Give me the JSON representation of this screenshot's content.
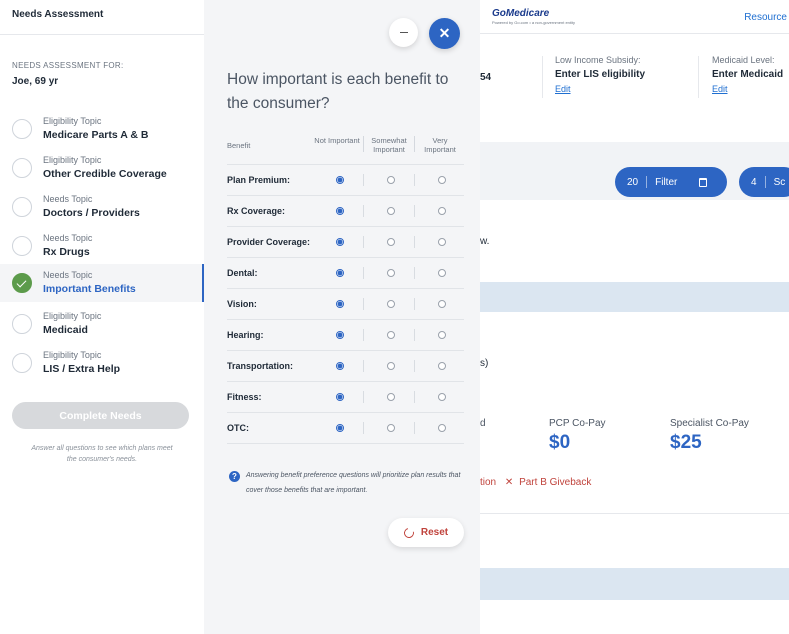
{
  "sidebar": {
    "title": "Needs Assessment",
    "for_label": "NEEDS ASSESSMENT FOR:",
    "consumer": "Joe, 69 yr",
    "topics": [
      {
        "type": "Eligibility Topic",
        "name": "Medicare Parts A & B",
        "status": "pending"
      },
      {
        "type": "Eligibility Topic",
        "name": "Other Credible Coverage",
        "status": "pending"
      },
      {
        "type": "Needs Topic",
        "name": "Doctors / Providers",
        "status": "pending"
      },
      {
        "type": "Needs Topic",
        "name": "Rx Drugs",
        "status": "pending"
      },
      {
        "type": "Needs Topic",
        "name": "Important Benefits",
        "status": "complete"
      },
      {
        "type": "Eligibility Topic",
        "name": "Medicaid",
        "status": "pending"
      },
      {
        "type": "Eligibility Topic",
        "name": "LIS / Extra Help",
        "status": "pending"
      }
    ],
    "complete_button": "Complete Needs",
    "hint": "Answer all questions to see which plans meet the consumer's needs."
  },
  "panel": {
    "title": "How important is each benefit to the consumer?",
    "headers": {
      "benefit": "Benefit",
      "not_important": "Not Important",
      "somewhat_important": "Somewhat Important",
      "very_important": "Very Important"
    },
    "benefits": [
      {
        "name": "Plan Premium:",
        "selected": "not"
      },
      {
        "name": "Rx Coverage:",
        "selected": "not"
      },
      {
        "name": "Provider Coverage:",
        "selected": "not"
      },
      {
        "name": "Dental:",
        "selected": "not"
      },
      {
        "name": "Vision:",
        "selected": "not"
      },
      {
        "name": "Hearing:",
        "selected": "not"
      },
      {
        "name": "Transportation:",
        "selected": "not"
      },
      {
        "name": "Fitness:",
        "selected": "not"
      },
      {
        "name": "OTC:",
        "selected": "not"
      }
    ],
    "note": "Answering benefit preference questions will prioritize plan results that cover those benefits that are important.",
    "reset_button": "Reset",
    "minimize_icon": "minus-icon",
    "close_icon": "close-icon"
  },
  "background": {
    "logo": "GoMedicare",
    "logo_sub": "Powered by Go.com • a non-government entity",
    "resources": "Resource",
    "partial_number": "54",
    "lis": {
      "label": "Low Income Subsidy:",
      "value": "Enter LIS eligibility",
      "edit": "Edit"
    },
    "medicaid": {
      "label": "Medicaid Level:",
      "value": "Enter Medicaid",
      "edit": "Edit"
    },
    "filter_count": "20",
    "filter_label": "Filter",
    "sort_count": "4",
    "sort_label": "Sc",
    "partial_w": "w.",
    "partial_s": "s)",
    "partial_d": "d",
    "pcp_label": "PCP Co-Pay",
    "pcp_value": "$0",
    "specialist_label": "Specialist Co-Pay",
    "specialist_value": "$25",
    "partial_tion": "tion",
    "giveback": "Part B Giveback"
  },
  "colors": {
    "accent": "#2d65c3",
    "success": "#5c9b4b",
    "danger": "#c0433c",
    "panel_bg": "#f4f5f7"
  }
}
